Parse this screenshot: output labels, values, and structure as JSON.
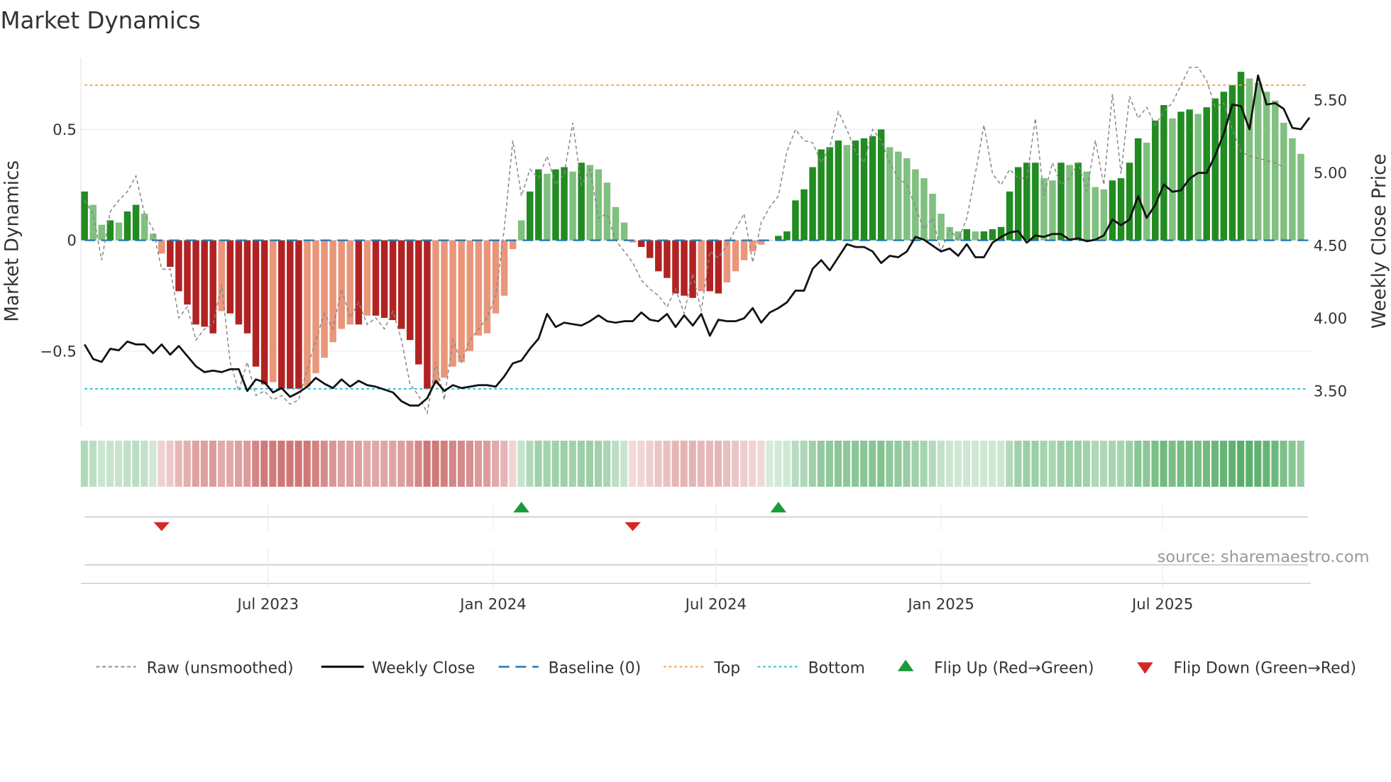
{
  "chart_data": {
    "type": "bar",
    "title": "Market Dynamics",
    "ylabel": "Market Dynamics",
    "y2label": "Weekly Close Price",
    "ylim": [
      -0.83,
      0.83
    ],
    "y2lim": [
      3.31,
      5.84
    ],
    "yticks": [
      {
        "v": 0.5,
        "label": "0.5"
      },
      {
        "v": 0,
        "label": "0"
      },
      {
        "v": -0.5,
        "label": "−0.5"
      }
    ],
    "y2ticks": [
      {
        "v": 5.5,
        "label": "5.50"
      },
      {
        "v": 5.0,
        "label": "5.00"
      },
      {
        "v": 4.5,
        "label": "4.50"
      },
      {
        "v": 4.0,
        "label": "4.00"
      },
      {
        "v": 3.5,
        "label": "3.50"
      }
    ],
    "start_date": "2023-02-01",
    "interval_days": 7,
    "xticks": [
      {
        "date": "2023-07-01",
        "label": "Jul 2023"
      },
      {
        "date": "2024-01-01",
        "label": "Jan 2024"
      },
      {
        "date": "2024-07-01",
        "label": "Jul 2024"
      },
      {
        "date": "2025-01-01",
        "label": "Jan 2025"
      },
      {
        "date": "2025-07-01",
        "label": "Jul 2025"
      }
    ],
    "top": 0.7,
    "bottom": -0.67,
    "baseline": 0,
    "smoothed": [
      0.22,
      0.16,
      0.07,
      0.09,
      0.08,
      0.13,
      0.16,
      0.12,
      0.03,
      -0.06,
      -0.12,
      -0.23,
      -0.29,
      -0.38,
      -0.39,
      -0.42,
      -0.32,
      -0.33,
      -0.38,
      -0.42,
      -0.57,
      -0.65,
      -0.64,
      -0.67,
      -0.67,
      -0.67,
      -0.66,
      -0.6,
      -0.53,
      -0.46,
      -0.4,
      -0.38,
      -0.38,
      -0.34,
      -0.34,
      -0.35,
      -0.36,
      -0.4,
      -0.45,
      -0.56,
      -0.67,
      -0.65,
      -0.62,
      -0.57,
      -0.55,
      -0.5,
      -0.43,
      -0.42,
      -0.33,
      -0.25,
      -0.04,
      0.09,
      0.22,
      0.32,
      0.3,
      0.32,
      0.33,
      0.31,
      0.35,
      0.34,
      0.32,
      0.26,
      0.15,
      0.08,
      -0.01,
      -0.03,
      -0.08,
      -0.14,
      -0.17,
      -0.24,
      -0.25,
      -0.26,
      -0.23,
      -0.23,
      -0.24,
      -0.19,
      -0.14,
      -0.09,
      -0.05,
      -0.02,
      0.0,
      0.02,
      0.04,
      0.18,
      0.23,
      0.33,
      0.41,
      0.42,
      0.45,
      0.43,
      0.45,
      0.46,
      0.47,
      0.5,
      0.42,
      0.4,
      0.37,
      0.32,
      0.28,
      0.21,
      0.12,
      0.06,
      0.04,
      0.05,
      0.04,
      0.04,
      0.05,
      0.06,
      0.22,
      0.33,
      0.35,
      0.35,
      0.28,
      0.27,
      0.35,
      0.34,
      0.35,
      0.31,
      0.24,
      0.23,
      0.27,
      0.28,
      0.35,
      0.46,
      0.44,
      0.54,
      0.61,
      0.55,
      0.58,
      0.59,
      0.57,
      0.6,
      0.64,
      0.67,
      0.7,
      0.76,
      0.73,
      0.71,
      0.67,
      0.63,
      0.53,
      0.46,
      0.39
    ],
    "raw": [
      0.18,
      0.12,
      -0.09,
      0.13,
      0.18,
      0.22,
      0.29,
      0.12,
      0.05,
      -0.13,
      -0.13,
      -0.35,
      -0.3,
      -0.45,
      -0.4,
      -0.38,
      -0.2,
      -0.55,
      -0.68,
      -0.55,
      -0.7,
      -0.68,
      -0.72,
      -0.7,
      -0.74,
      -0.72,
      -0.58,
      -0.45,
      -0.33,
      -0.4,
      -0.22,
      -0.35,
      -0.28,
      -0.38,
      -0.35,
      -0.4,
      -0.32,
      -0.45,
      -0.65,
      -0.7,
      -0.78,
      -0.55,
      -0.72,
      -0.45,
      -0.55,
      -0.45,
      -0.4,
      -0.35,
      -0.25,
      0.05,
      0.45,
      0.2,
      0.32,
      0.28,
      0.38,
      0.25,
      0.3,
      0.53,
      0.25,
      0.32,
      0.1,
      0.12,
      0.0,
      -0.05,
      -0.1,
      -0.18,
      -0.22,
      -0.25,
      -0.3,
      -0.22,
      -0.33,
      -0.15,
      -0.32,
      -0.05,
      -0.08,
      -0.02,
      0.05,
      0.12,
      -0.1,
      0.08,
      0.15,
      0.2,
      0.4,
      0.5,
      0.45,
      0.44,
      0.35,
      0.42,
      0.58,
      0.5,
      0.4,
      0.35,
      0.5,
      0.45,
      0.35,
      0.28,
      0.25,
      0.15,
      0.05,
      0.1,
      -0.05,
      0.05,
      0.0,
      0.1,
      0.3,
      0.52,
      0.3,
      0.25,
      0.32,
      0.28,
      0.28,
      0.55,
      0.2,
      0.35,
      0.25,
      0.28,
      0.35,
      0.22,
      0.45,
      0.25,
      0.66,
      0.3,
      0.65,
      0.55,
      0.6,
      0.52,
      0.58,
      0.62,
      0.7,
      0.78,
      0.78,
      0.72,
      0.6,
      0.62,
      0.5,
      0.4,
      0.38,
      0.37,
      0.36,
      0.35,
      0.33
    ],
    "close": [
      3.82,
      3.72,
      3.7,
      3.79,
      3.78,
      3.84,
      3.82,
      3.82,
      3.76,
      3.82,
      3.75,
      3.81,
      3.74,
      3.67,
      3.63,
      3.64,
      3.63,
      3.65,
      3.65,
      3.5,
      3.58,
      3.56,
      3.49,
      3.52,
      3.46,
      3.49,
      3.53,
      3.59,
      3.55,
      3.52,
      3.58,
      3.53,
      3.57,
      3.54,
      3.53,
      3.51,
      3.49,
      3.43,
      3.4,
      3.4,
      3.45,
      3.57,
      3.5,
      3.54,
      3.52,
      3.53,
      3.54,
      3.54,
      3.53,
      3.6,
      3.69,
      3.71,
      3.79,
      3.86,
      4.03,
      3.94,
      3.97,
      3.96,
      3.95,
      3.98,
      4.02,
      3.98,
      3.97,
      3.98,
      3.98,
      4.04,
      3.99,
      3.98,
      4.03,
      3.94,
      4.02,
      3.95,
      4.03,
      3.88,
      3.99,
      3.98,
      3.98,
      4.0,
      4.07,
      3.97,
      4.04,
      4.07,
      4.11,
      4.19,
      4.19,
      4.34,
      4.4,
      4.33,
      4.42,
      4.51,
      4.49,
      4.49,
      4.46,
      4.38,
      4.43,
      4.42,
      4.46,
      4.56,
      4.54,
      4.5,
      4.46,
      4.48,
      4.43,
      4.51,
      4.42,
      4.42,
      4.52,
      4.56,
      4.59,
      4.6,
      4.52,
      4.57,
      4.56,
      4.58,
      4.58,
      4.54,
      4.55,
      4.53,
      4.54,
      4.57,
      4.68,
      4.64,
      4.68,
      4.84,
      4.69,
      4.78,
      4.92,
      4.87,
      4.88,
      4.96,
      5.0,
      5.0,
      5.12,
      5.27,
      5.47,
      5.46,
      5.3,
      5.67,
      5.47,
      5.48,
      5.44,
      5.31,
      5.3,
      5.38
    ],
    "flips": [
      {
        "date": "2023-04-05",
        "direction": "down"
      },
      {
        "date": "2024-01-24",
        "direction": "up"
      },
      {
        "date": "2024-04-24",
        "direction": "down"
      },
      {
        "date": "2024-08-21",
        "direction": "up"
      }
    ],
    "legend": {
      "placement": "bottom",
      "entries": [
        "Raw (unsmoothed)",
        "Weekly Close",
        "Baseline (0)",
        "Top",
        "Bottom",
        "Flip Up (Red→Green)",
        "Flip Down (Green→Red)"
      ]
    },
    "source": "source: sharemaestro.com",
    "colors": {
      "green_dark": "#228b22",
      "green_light": "#80c080",
      "red_dark": "#b22222",
      "red_light": "#e9967a",
      "top": "#f0a050",
      "bottom": "#20c0d0",
      "baseline": "#1f77b4",
      "flip_up": "#1a9a3a",
      "flip_down": "#d62728"
    }
  }
}
